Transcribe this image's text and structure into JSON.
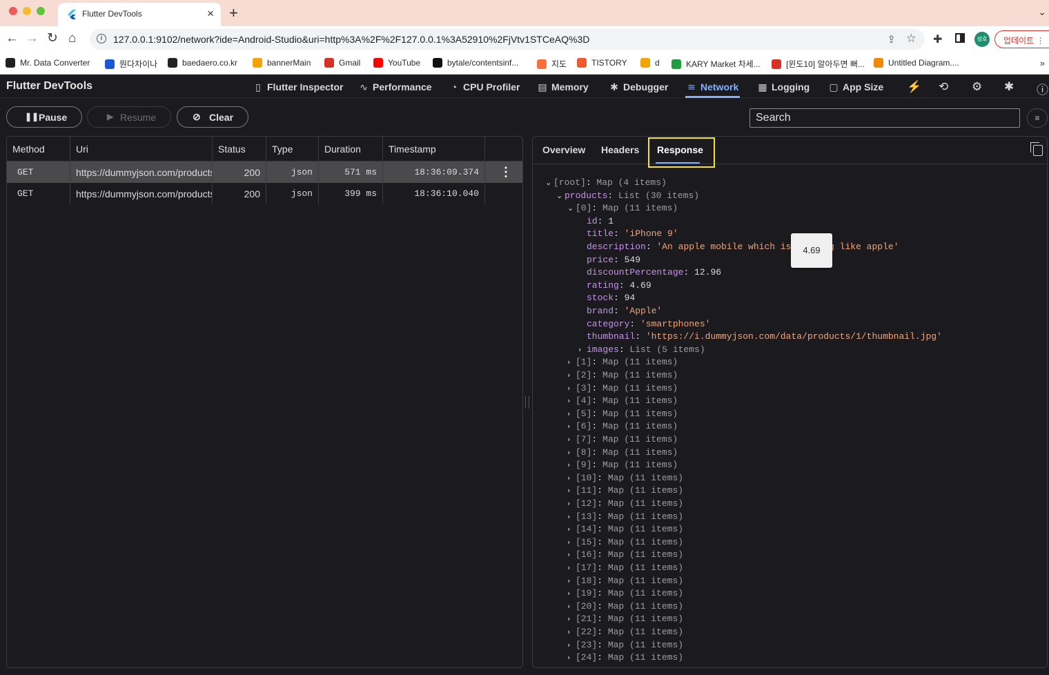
{
  "browser": {
    "tab_title": "Flutter DevTools",
    "url": "127.0.0.1:9102/network?ide=Android-Studio&uri=http%3A%2F%2F127.0.0.1%3A52910%2FjVtv1STCeAQ%3D",
    "profile_initials": "성호",
    "update_label": "업데이트",
    "bookmarks": [
      {
        "label": "Mr. Data Converter",
        "icon": "globe-icon",
        "color": "#222222"
      },
      {
        "label": "뭔다차이나",
        "icon": "doc-icon",
        "color": "#1a57d6"
      },
      {
        "label": "baedaero.co.kr",
        "icon": "globe-icon",
        "color": "#222222"
      },
      {
        "label": "bannerMain",
        "icon": "firebase-icon",
        "color": "#f4a300"
      },
      {
        "label": "Gmail",
        "icon": "gmail-icon",
        "color": "#d93025"
      },
      {
        "label": "YouTube",
        "icon": "youtube-icon",
        "color": "#ff0000"
      },
      {
        "label": "bytale/contentsinf...",
        "icon": "github-icon",
        "color": "#111111"
      },
      {
        "label": "지도",
        "icon": "map-pin-icon",
        "color": "#ff6d3a"
      },
      {
        "label": "TISTORY",
        "icon": "tistory-icon",
        "color": "#ef5a2f"
      },
      {
        "label": "d",
        "icon": "firebase-icon",
        "color": "#f4a300"
      },
      {
        "label": "KARY Market 차세...",
        "icon": "flag-icon",
        "color": "#1e9e3e"
      },
      {
        "label": "[윈도10] 알아두면 뻐...",
        "icon": "bookmark-icon",
        "color": "#d93025"
      },
      {
        "label": "Untitled Diagram....",
        "icon": "drawio-icon",
        "color": "#f08705"
      }
    ]
  },
  "devtools": {
    "title": "Flutter DevTools",
    "tabs": [
      {
        "label": "Flutter Inspector",
        "icon": "phone-icon"
      },
      {
        "label": "Performance",
        "icon": "pulse-icon"
      },
      {
        "label": "CPU Profiler",
        "icon": "gauge-icon"
      },
      {
        "label": "Memory",
        "icon": "memory-icon"
      },
      {
        "label": "Debugger",
        "icon": "bug-icon"
      },
      {
        "label": "Network",
        "icon": "wifi-icon",
        "active": true
      },
      {
        "label": "Logging",
        "icon": "logging-icon"
      },
      {
        "label": "App Size",
        "icon": "file-icon"
      }
    ],
    "accent_color": "#82b1ff"
  },
  "controls": {
    "pause_label": "Pause",
    "resume_label": "Resume",
    "clear_label": "Clear",
    "search_placeholder": "Search"
  },
  "requests": {
    "columns": [
      "Method",
      "Uri",
      "Status",
      "Type",
      "Duration",
      "Timestamp"
    ],
    "rows": [
      {
        "method": "GET",
        "uri": "https://dummyjson.com/products",
        "status": "200",
        "type": "json",
        "duration": "571 ms",
        "timestamp": "18:36:09.374",
        "selected": true
      },
      {
        "method": "GET",
        "uri": "https://dummyjson.com/products",
        "status": "200",
        "type": "json",
        "duration": "399 ms",
        "timestamp": "18:36:10.040",
        "selected": false
      }
    ]
  },
  "detail": {
    "tabs": [
      "Overview",
      "Headers",
      "Response"
    ],
    "active_tab": "Response",
    "tooltip": "4.69",
    "tree": {
      "root": {
        "label": "[root]",
        "summary": "Map (4 items)"
      },
      "products": {
        "label": "products",
        "summary": "List (30 items)"
      },
      "item0": {
        "label": "[0]",
        "summary": "Map (11 items)"
      },
      "fields": [
        {
          "key": "id",
          "value": "1",
          "kind": "num"
        },
        {
          "key": "title",
          "value": "'iPhone 9'",
          "kind": "str"
        },
        {
          "key": "description",
          "value": "'An apple mobile which is nothing like apple'",
          "kind": "str"
        },
        {
          "key": "price",
          "value": "549",
          "kind": "num"
        },
        {
          "key": "discountPercentage",
          "value": "12.96",
          "kind": "num"
        },
        {
          "key": "rating",
          "value": "4.69",
          "kind": "num"
        },
        {
          "key": "stock",
          "value": "94",
          "kind": "num"
        },
        {
          "key": "brand",
          "value": "'Apple'",
          "kind": "str"
        },
        {
          "key": "category",
          "value": "'smartphones'",
          "kind": "str"
        },
        {
          "key": "thumbnail",
          "value": "'https://i.dummyjson.com/data/products/1/thumbnail.jpg'",
          "kind": "str"
        }
      ],
      "images": {
        "label": "images",
        "summary": "List (5 items)"
      },
      "collapsed_items": [
        "[1]",
        "[2]",
        "[3]",
        "[4]",
        "[5]",
        "[6]",
        "[7]",
        "[8]",
        "[9]",
        "[10]",
        "[11]",
        "[12]",
        "[13]",
        "[14]",
        "[15]",
        "[16]",
        "[17]",
        "[18]",
        "[19]",
        "[20]",
        "[21]",
        "[22]",
        "[23]",
        "[24]"
      ],
      "collapsed_summary": "Map (11 items)"
    }
  }
}
